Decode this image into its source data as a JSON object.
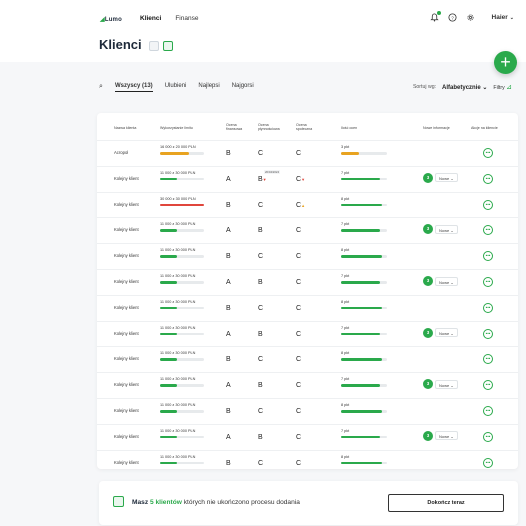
{
  "app": {
    "logo_text": "Lumo",
    "nav": [
      {
        "label": "Klienci",
        "active": true
      },
      {
        "label": "Finanse",
        "active": false
      }
    ],
    "user_name": "Haier",
    "accent": "#2aa94b"
  },
  "page": {
    "title": "Klienci",
    "fab_label": "+"
  },
  "filters": {
    "tabs": [
      "Wszyscy (13)",
      "Ulubieni",
      "Najlepsi",
      "Najgorsi"
    ],
    "sort_label": "Sortuj wg:",
    "sort_value": "Alfabetycznie",
    "filters_label": "Filtry"
  },
  "table": {
    "headers": {
      "name": "Nazwa klienta",
      "limit": "Wykorzystanie limitu",
      "grade_fin": "Ocena finansowa",
      "grade_pay": "Ocena płynnościowa",
      "grade_soc": "Ocena społeczna",
      "days": "Ilość ocen",
      "info": "Nowe informacje",
      "actions": "Akcje na kliencie"
    },
    "rows": [
      {
        "name": "Acropol",
        "limit": "16 000 z 20 000 PLN",
        "limit_pct": 0.65,
        "limit_color": "#e8a320",
        "g1": "B",
        "g2": "C",
        "g2_arrow": "",
        "g3": "C",
        "g3_arrow": "",
        "days": "3 pkt",
        "days_pct": 0.4,
        "days_color": "#e8a320",
        "info": "",
        "tag": ""
      },
      {
        "name": "Kolejny klient",
        "limit": "11 000 z 30 000 PLN",
        "limit_pct": 0.38,
        "limit_color": "#2aa94b",
        "g1": "A",
        "g2": "B",
        "g2_arrow": "▼",
        "g3": "C",
        "g3_arrow": "▼",
        "days": "7 pkt",
        "days_pct": 0.85,
        "days_color": "#2aa94b",
        "info": "3",
        "tag": "20/04/2024"
      },
      {
        "name": "Kolejny klient",
        "limit": "30 000 z 30 000 PLN",
        "limit_pct": 1.0,
        "limit_color": "#e0463c",
        "g1": "B",
        "g2": "C",
        "g2_arrow": "",
        "g3": "C",
        "g3_arrow": "▲",
        "days": "8 pkt",
        "days_pct": 0.9,
        "days_color": "#2aa94b",
        "info": "",
        "tag": ""
      },
      {
        "name": "Kolejny klient",
        "limit": "11 000 z 30 000 PLN",
        "limit_pct": 0.38,
        "limit_color": "#2aa94b",
        "g1": "A",
        "g2": "B",
        "g2_arrow": "",
        "g3": "C",
        "g3_arrow": "",
        "days": "7 pkt",
        "days_pct": 0.85,
        "days_color": "#2aa94b",
        "info": "3",
        "tag": ""
      },
      {
        "name": "Kolejny klient",
        "limit": "11 000 z 30 000 PLN",
        "limit_pct": 0.38,
        "limit_color": "#2aa94b",
        "g1": "B",
        "g2": "C",
        "g2_arrow": "",
        "g3": "C",
        "g3_arrow": "",
        "days": "8 pkt",
        "days_pct": 0.9,
        "days_color": "#2aa94b",
        "info": "",
        "tag": ""
      },
      {
        "name": "Kolejny klient",
        "limit": "11 000 z 30 000 PLN",
        "limit_pct": 0.38,
        "limit_color": "#2aa94b",
        "g1": "A",
        "g2": "B",
        "g2_arrow": "",
        "g3": "C",
        "g3_arrow": "",
        "days": "7 pkt",
        "days_pct": 0.85,
        "days_color": "#2aa94b",
        "info": "3",
        "tag": ""
      },
      {
        "name": "Kolejny klient",
        "limit": "11 000 z 30 000 PLN",
        "limit_pct": 0.38,
        "limit_color": "#2aa94b",
        "g1": "B",
        "g2": "C",
        "g2_arrow": "",
        "g3": "C",
        "g3_arrow": "",
        "days": "8 pkt",
        "days_pct": 0.9,
        "days_color": "#2aa94b",
        "info": "",
        "tag": ""
      },
      {
        "name": "Kolejny klient",
        "limit": "11 000 z 30 000 PLN",
        "limit_pct": 0.38,
        "limit_color": "#2aa94b",
        "g1": "A",
        "g2": "B",
        "g2_arrow": "",
        "g3": "C",
        "g3_arrow": "",
        "days": "7 pkt",
        "days_pct": 0.85,
        "days_color": "#2aa94b",
        "info": "3",
        "tag": ""
      },
      {
        "name": "Kolejny klient",
        "limit": "11 000 z 30 000 PLN",
        "limit_pct": 0.38,
        "limit_color": "#2aa94b",
        "g1": "B",
        "g2": "C",
        "g2_arrow": "",
        "g3": "C",
        "g3_arrow": "",
        "days": "8 pkt",
        "days_pct": 0.9,
        "days_color": "#2aa94b",
        "info": "",
        "tag": ""
      },
      {
        "name": "Kolejny klient",
        "limit": "11 000 z 30 000 PLN",
        "limit_pct": 0.38,
        "limit_color": "#2aa94b",
        "g1": "A",
        "g2": "B",
        "g2_arrow": "",
        "g3": "C",
        "g3_arrow": "",
        "days": "7 pkt",
        "days_pct": 0.85,
        "days_color": "#2aa94b",
        "info": "3",
        "tag": ""
      },
      {
        "name": "Kolejny klient",
        "limit": "11 000 z 30 000 PLN",
        "limit_pct": 0.38,
        "limit_color": "#2aa94b",
        "g1": "B",
        "g2": "C",
        "g2_arrow": "",
        "g3": "C",
        "g3_arrow": "",
        "days": "8 pkt",
        "days_pct": 0.9,
        "days_color": "#2aa94b",
        "info": "",
        "tag": ""
      },
      {
        "name": "Kolejny klient",
        "limit": "11 000 z 30 000 PLN",
        "limit_pct": 0.38,
        "limit_color": "#2aa94b",
        "g1": "A",
        "g2": "B",
        "g2_arrow": "",
        "g3": "C",
        "g3_arrow": "",
        "days": "7 pkt",
        "days_pct": 0.85,
        "days_color": "#2aa94b",
        "info": "3",
        "tag": ""
      },
      {
        "name": "Kolejny klient",
        "limit": "11 000 z 30 000 PLN",
        "limit_pct": 0.38,
        "limit_color": "#2aa94b",
        "g1": "B",
        "g2": "C",
        "g2_arrow": "",
        "g3": "C",
        "g3_arrow": "",
        "days": "8 pkt",
        "days_pct": 0.9,
        "days_color": "#2aa94b",
        "info": "",
        "tag": ""
      }
    ],
    "info_label": "Nowe",
    "action_icon": "more-icon"
  },
  "bottom": {
    "text_prefix": "Masz",
    "count_text": "5 klientów",
    "text_suffix": "których nie ukończono procesu dodania",
    "button_label": "Dokończ teraz"
  }
}
